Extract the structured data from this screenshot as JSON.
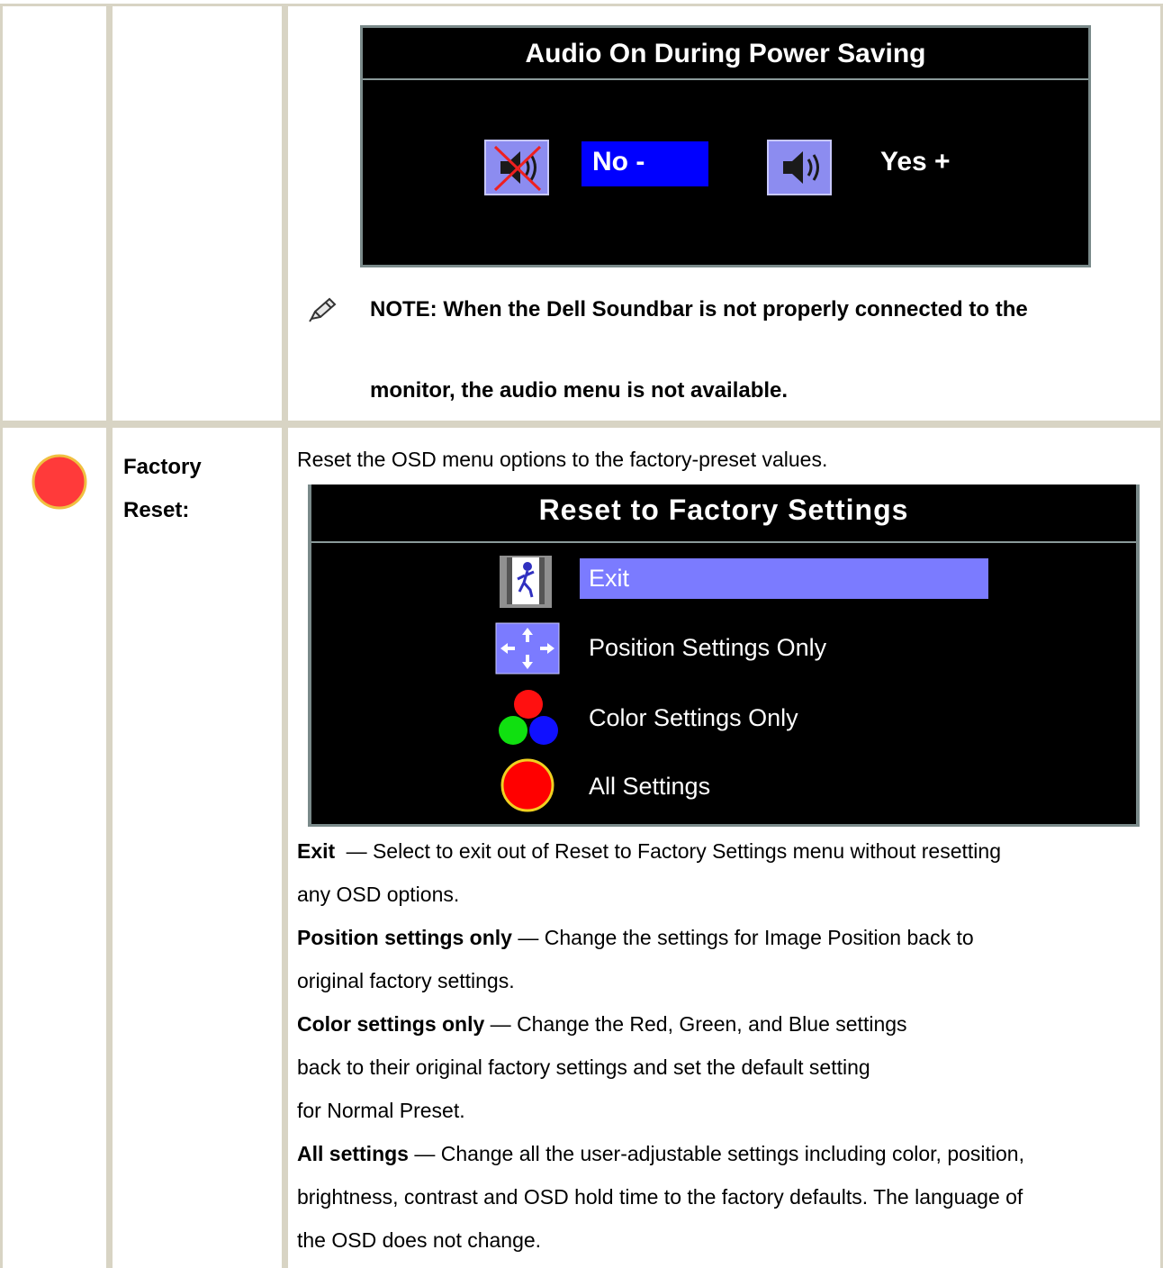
{
  "audio_osd": {
    "title": "Audio On During Power Saving",
    "no_label": "No -",
    "yes_label": "Yes +",
    "selected": "No -"
  },
  "note": {
    "icon": "note-pencil-icon",
    "line1": "NOTE: When the Dell Soundbar is not properly connected to the",
    "line2": "monitor, the audio menu is not available."
  },
  "factory_reset": {
    "icon": "red-circle-icon",
    "label_line1": "Factory",
    "label_line2": "Reset:",
    "intro": "Reset the OSD menu options to the factory-preset values.",
    "osd": {
      "title": "Reset to Factory Settings",
      "items": [
        {
          "label": "Exit",
          "icon": "exit-door-icon",
          "selected": true
        },
        {
          "label": "Position Settings Only",
          "icon": "position-arrows-icon",
          "selected": false
        },
        {
          "label": "Color Settings Only",
          "icon": "rgb-circles-icon",
          "selected": false
        },
        {
          "label": "All Settings",
          "icon": "all-settings-circle-icon",
          "selected": false
        }
      ]
    },
    "descriptions": [
      {
        "term": "Exit",
        "line1": " — Select to exit out of Reset to Factory Settings menu without resetting",
        "line2": "any OSD options."
      },
      {
        "term": "Position settings only",
        "line1": " — Change the settings for Image Position back to",
        "line2": "original factory settings."
      },
      {
        "term": "Color settings only",
        "line1": " — Change the Red, Green, and Blue settings",
        "line2": "back to their original factory settings and set the default setting",
        "line3": "for Normal Preset."
      },
      {
        "term": "All settings",
        "line1": " — Change all the user-adjustable settings including color, position,",
        "line2": "brightness, contrast and OSD hold time to the factory defaults. The language of",
        "line3": "the OSD does not change."
      }
    ]
  },
  "colors": {
    "border": "#d8d4c4",
    "osd_background": "#000000",
    "audio_selected": "#0000ff",
    "reset_selected": "#7b7bff"
  }
}
